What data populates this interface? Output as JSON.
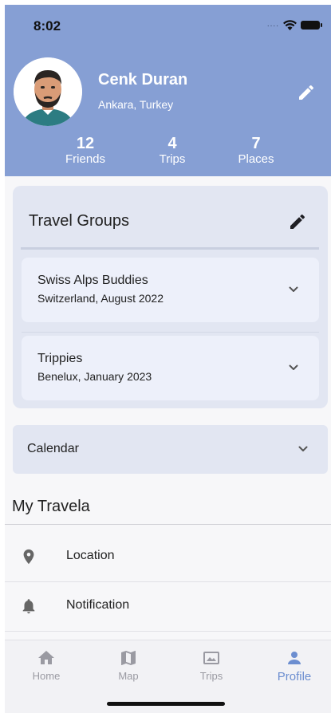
{
  "status_bar": {
    "time": "8:02",
    "signal_dots": "....",
    "icons": [
      "wifi-icon",
      "battery-icon"
    ]
  },
  "profile": {
    "name": "Cenk Duran",
    "location": "Ankara, Turkey",
    "avatar": "avatar-illustration",
    "edit_icon": "pencil-icon",
    "stats": [
      {
        "value": "12",
        "label": "Friends"
      },
      {
        "value": "4",
        "label": "Trips"
      },
      {
        "value": "7",
        "label": "Places"
      }
    ]
  },
  "travel_groups": {
    "title": "Travel Groups",
    "edit_icon": "pencil-icon",
    "items": [
      {
        "title": "Swiss Alps Buddies",
        "subtitle": "Switzerland, August 2022"
      },
      {
        "title": "Trippies",
        "subtitle": "Benelux, January 2023"
      }
    ]
  },
  "calendar": {
    "label": "Calendar"
  },
  "my_travela": {
    "title": "My Travela",
    "items": [
      {
        "label": "Location",
        "icon": "location-pin-icon"
      },
      {
        "label": "Notification",
        "icon": "bell-icon"
      }
    ]
  },
  "bottom_nav": {
    "items": [
      {
        "label": "Home",
        "icon": "home-icon"
      },
      {
        "label": "Map",
        "icon": "map-icon"
      },
      {
        "label": "Trips",
        "icon": "trips-icon"
      },
      {
        "label": "Profile",
        "icon": "profile-icon"
      }
    ],
    "active": "Profile"
  },
  "colors": {
    "header": "#869fd4",
    "card": "#e2e6f2",
    "inner_card": "#edf0fa",
    "active_nav": "#6c8ed0",
    "inactive_nav": "#9a9aa2"
  }
}
